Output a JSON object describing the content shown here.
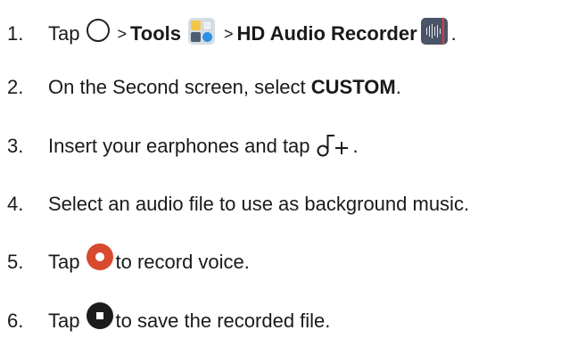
{
  "steps": [
    {
      "number": "1.",
      "parts": {
        "tap": "Tap",
        "gt1": ">",
        "tools": "Tools",
        "gt2": ">",
        "recorder": "HD Audio Recorder",
        "end": "."
      },
      "icons": [
        "home-icon",
        "tools-folder-icon",
        "hd-audio-recorder-icon"
      ]
    },
    {
      "number": "2.",
      "parts": {
        "text": "On the Second screen, select",
        "bold": "CUSTOM",
        "end": "."
      }
    },
    {
      "number": "3.",
      "parts": {
        "text": "Insert your earphones and tap",
        "end": "."
      },
      "icons": [
        "add-music-icon"
      ]
    },
    {
      "number": "4.",
      "parts": {
        "text": "Select an audio file to use as background music."
      }
    },
    {
      "number": "5.",
      "parts": {
        "tap": "Tap",
        "text": "to record voice."
      },
      "icons": [
        "record-icon"
      ]
    },
    {
      "number": "6.",
      "parts": {
        "tap": "Tap",
        "text": "to save the recorded file."
      },
      "icons": [
        "stop-icon"
      ]
    }
  ],
  "colors": {
    "text": "#1a1a1a",
    "record": "#d84a2d",
    "stop": "#1c1c1c",
    "tools_accent": "#2d8fe6",
    "recorder_bg": "#4a5468"
  }
}
